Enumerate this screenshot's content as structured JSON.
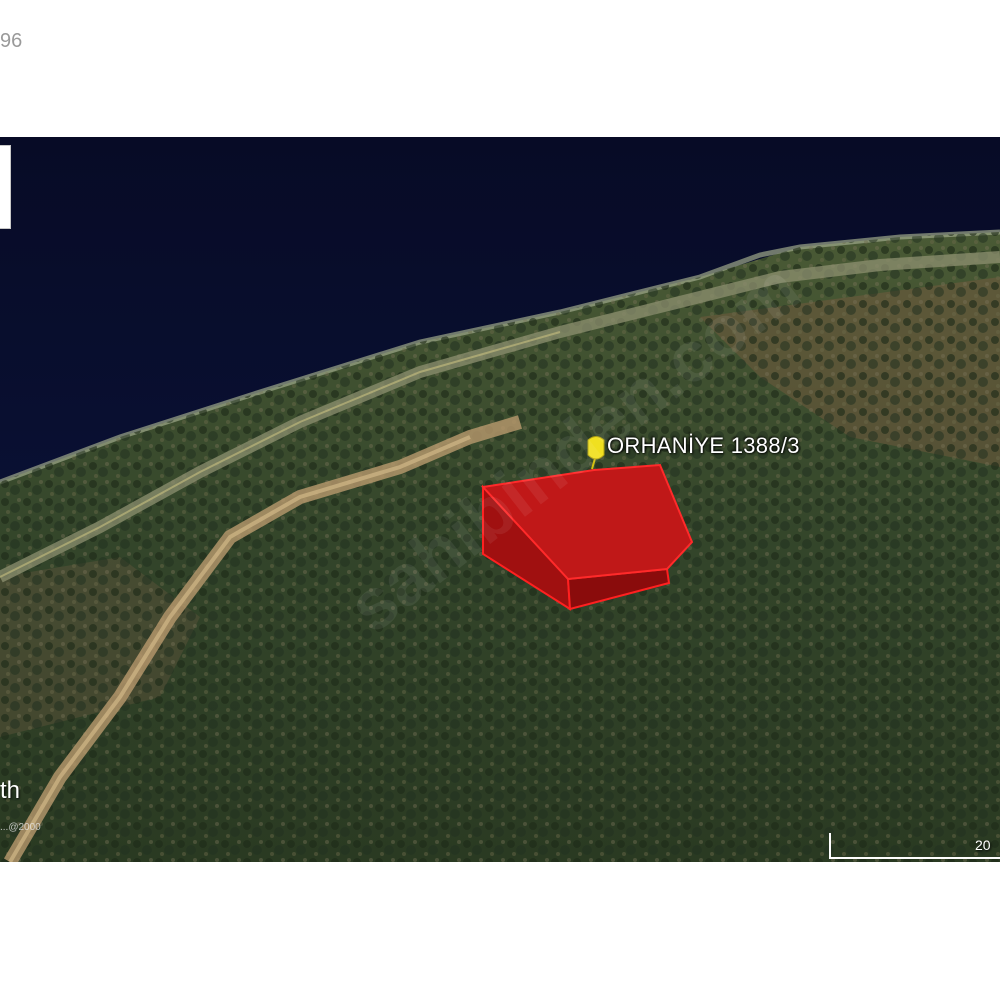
{
  "header": {
    "text": "96"
  },
  "map": {
    "parcel_label": "ORHANİYE 1388/3",
    "logo_text": "th",
    "copyright": "...@2000",
    "scale_text": "20",
    "watermark": "sahibinden.com",
    "pin_icon": "pushpin-icon",
    "colors": {
      "sea": "#0a0f33",
      "forest": "#2e3d24",
      "parcel": "#c01818",
      "pin": "#f0e020"
    }
  }
}
